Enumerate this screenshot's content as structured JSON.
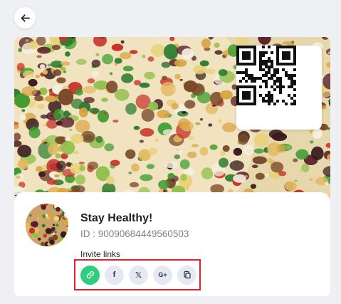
{
  "profile": {
    "name": "Stay Healthy!",
    "id_text": "ID : 90090684449560503"
  },
  "invite": {
    "label": "Invite links",
    "buttons": [
      {
        "name": "copy-link",
        "icon": "link-icon"
      },
      {
        "name": "facebook",
        "icon": "facebook-icon",
        "glyph": "f"
      },
      {
        "name": "x-twitter",
        "icon": "x-icon",
        "glyph": "𝕏"
      },
      {
        "name": "google-plus",
        "icon": "google-plus-icon",
        "glyph": "G+"
      },
      {
        "name": "copy",
        "icon": "copy-icon"
      }
    ]
  },
  "colors": {
    "accent_green": "#2fce7e",
    "highlight_red": "#e0212a",
    "button_bg": "#e6e9f2"
  }
}
